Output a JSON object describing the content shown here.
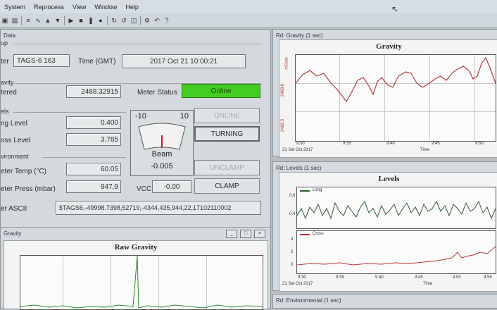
{
  "menu": [
    "System",
    "Reprocess",
    "View",
    "Window",
    "Help"
  ],
  "data_panel": {
    "title": "Data",
    "group_setup": "up",
    "meter_label": "ter",
    "meter_value": "TAGS-6 163",
    "time_label": "Time (GMT)",
    "time_value": "2017 Oct 21 10:00:21",
    "group_gravity": "avity",
    "filtered_label": "tered",
    "filtered_value": "2488.32915",
    "meter_status_label": "Meter Status",
    "meter_status_value": "Online",
    "group_levels": "els",
    "long_level_label": "ng Level",
    "long_level_value": "0.400",
    "cross_level_label": "oss Level",
    "cross_level_value": "3.785",
    "group_env": "vironment",
    "temp_label": "eter Temp (°C)",
    "temp_value": "60.05",
    "press_label": "eter Press (mbar)",
    "press_value": "947.9",
    "beam_min": "-10",
    "beam_max": "10",
    "beam_label": "Beam",
    "beam_value": "-0.005",
    "vcc_label": "VCC",
    "vcc_value": "-0.00",
    "btn_online": "ONLINE",
    "btn_turning": "TURNING",
    "btn_unclamp": "UNCLAMP",
    "btn_clamp": "CLAMP",
    "ascii_label": "er ASCII",
    "ascii_value": "$TAGS6,-49998.7398,52719,-4344,435,944,22,17102110002"
  },
  "raw_gravity": {
    "title_bar": "Gravity",
    "chart_title": "Raw Gravity"
  },
  "gravity_panel": {
    "title_bar": "Rd: Gravity (1 sec)",
    "chart_title": "Gravity",
    "ylabel": "mGals",
    "yticks": [
      "2488.5",
      "2488.6"
    ],
    "xticks": [
      "9:30",
      "9:35",
      "9:40",
      "9:45",
      "9:50"
    ],
    "date": "21 Sat Oct 2017",
    "xlabel": "Time"
  },
  "levels_panel": {
    "title_bar": "Rd: Levels (1 sec)",
    "chart_title": "Levels",
    "long_legend": "Long",
    "cross_legend": "Cross",
    "long_ticks": [
      "0.6",
      "0.4"
    ],
    "cross_ticks": [
      "4",
      "2",
      "0"
    ],
    "xticks": [
      "9:30",
      "9:35",
      "9:40",
      "9:45",
      "9:50",
      "9:55"
    ],
    "date": "21 Sat Oct 2017",
    "xlabel": "Time"
  },
  "env_panel": {
    "title_bar": "Rd: Environmental (1 sec)"
  },
  "colors": {
    "online": "#44cc22",
    "gravity_line": "#b03a3a",
    "long_line": "#2e5a2e",
    "cross_line": "#b23030"
  }
}
